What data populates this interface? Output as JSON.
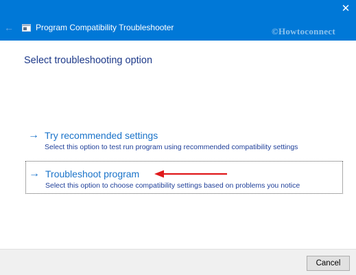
{
  "window": {
    "title": "Program Compatibility Troubleshooter",
    "close_glyph": "✕",
    "back_glyph": "←",
    "watermark": "©Howtoconnect",
    "accent_color": "#0078d7"
  },
  "main": {
    "heading": "Select troubleshooting option",
    "options": [
      {
        "icon": "arrow-right-icon",
        "arrow_glyph": "→",
        "title": "Try recommended settings",
        "description": "Select this option to test run program using recommended compatibility settings"
      },
      {
        "icon": "arrow-right-icon",
        "arrow_glyph": "→",
        "title": "Troubleshoot program",
        "description": "Select this option to choose compatibility settings based on problems you notice",
        "annotation_color": "#e0191b"
      }
    ]
  },
  "footer": {
    "cancel_label": "Cancel"
  }
}
